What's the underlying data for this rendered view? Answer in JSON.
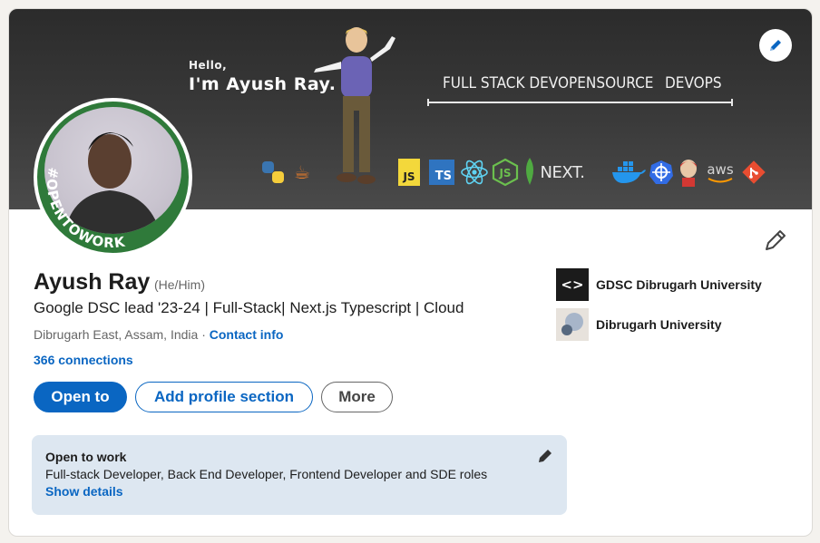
{
  "banner": {
    "greeting": "Hello,",
    "name": "I'm Ayush Ray.",
    "roles": [
      "FULL STACK DEV",
      "OPENSOURCE",
      "DEVOPS"
    ],
    "tech_icons": [
      "python-icon",
      "java-icon",
      "javascript-icon",
      "typescript-icon",
      "react-icon",
      "nodejs-icon",
      "mongodb-icon",
      "nextjs-icon",
      "docker-icon",
      "kubernetes-icon",
      "jenkins-icon",
      "aws-icon",
      "git-icon"
    ],
    "tech_labels": {
      "js": "JS",
      "ts": "TS",
      "next": "NEXT.",
      "aws": "aws"
    }
  },
  "avatar": {
    "badge_text": "#OPENTOWORK"
  },
  "profile": {
    "name": "Ayush Ray",
    "pronouns": "(He/Him)",
    "headline": "Google DSC lead '23-24 | Full-Stack| Next.js Typescript | Cloud",
    "location": "Dibrugarh East, Assam, India",
    "separator": " · ",
    "contact_label": "Contact info",
    "connections": "366 connections"
  },
  "actions": {
    "open_to": "Open to",
    "add_section": "Add profile section",
    "more": "More"
  },
  "organizations": [
    {
      "name": "GDSC Dibrugarh University",
      "logo_text": "<>"
    },
    {
      "name": "Dibrugarh University"
    }
  ],
  "open_to_work": {
    "title": "Open to work",
    "roles": "Full-stack Developer, Back End Developer, Frontend Developer and SDE roles",
    "link": "Show details"
  },
  "colors": {
    "accent": "#0a66c2",
    "open_to_work_green": "#2f7a3a",
    "open_to_work_box": "#dde7f1"
  }
}
